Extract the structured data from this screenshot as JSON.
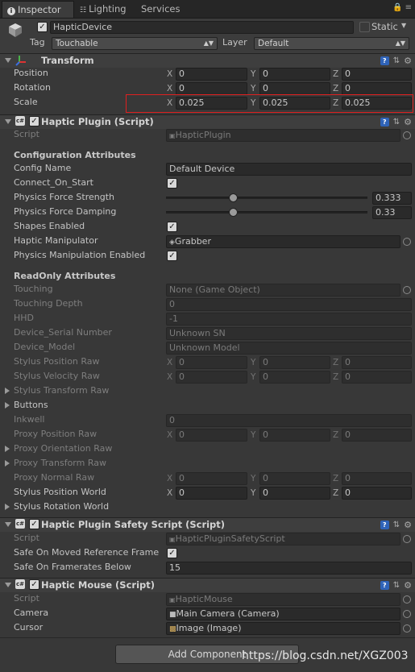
{
  "tabs": [
    {
      "label": "Inspector",
      "icon": "info-icon"
    },
    {
      "label": "Lighting",
      "icon": "lighting-icon"
    },
    {
      "label": "Services",
      "icon": ""
    }
  ],
  "gameobject": {
    "name": "HapticDevice",
    "static_label": "Static",
    "tag_label": "Tag",
    "tag_value": "Touchable",
    "layer_label": "Layer",
    "layer_value": "Default"
  },
  "transform": {
    "title": "Transform",
    "rows": [
      {
        "label": "Position",
        "x": "0",
        "y": "0",
        "z": "0"
      },
      {
        "label": "Rotation",
        "x": "0",
        "y": "0",
        "z": "0"
      },
      {
        "label": "Scale",
        "x": "0.025",
        "y": "0.025",
        "z": "0.025"
      }
    ]
  },
  "axes": {
    "x": "X",
    "y": "Y",
    "z": "Z"
  },
  "haptic_plugin": {
    "title": "Haptic Plugin (Script)",
    "script_label": "Script",
    "script_value": "HapticPlugin",
    "config_header": "Configuration Attributes",
    "config_name_label": "Config Name",
    "config_name_value": "Default Device",
    "connect_label": "Connect_On_Start",
    "force_strength_label": "Physics Force Strength",
    "force_strength_value": "0.333",
    "force_strength_level": 0.333,
    "force_damping_label": "Physics Force Damping",
    "force_damping_value": "0.33",
    "force_damping_level": 0.33,
    "shapes_label": "Shapes Enabled",
    "manipulator_label": "Haptic Manipulator",
    "manipulator_value": "Grabber",
    "manip_enabled_label": "Physics Manipulation Enabled",
    "readonly_header": "ReadOnly Attributes",
    "touching_label": "Touching",
    "touching_value": "None (Game Object)",
    "touching_depth_label": "Touching Depth",
    "touching_depth_value": "0",
    "hhd_label": "HHD",
    "hhd_value": "-1",
    "serial_label": "Device_Serial Number",
    "serial_value": "Unknown SN",
    "model_label": "Device_Model",
    "model_value": "Unknown Model",
    "stylus_pos_raw_label": "Stylus Position Raw",
    "stylus_vel_raw_label": "Stylus Velocity Raw",
    "stylus_transform_raw_label": "Stylus Transform Raw",
    "buttons_label": "Buttons",
    "inkwell_label": "Inkwell",
    "inkwell_value": "0",
    "proxy_pos_raw_label": "Proxy Position Raw",
    "proxy_orient_raw_label": "Proxy Orientation Raw",
    "proxy_transform_raw_label": "Proxy Transform Raw",
    "proxy_normal_raw_label": "Proxy Normal Raw",
    "stylus_pos_world_label": "Stylus Position World",
    "stylus_rot_world_label": "Stylus Rotation World",
    "zero": "0"
  },
  "safety": {
    "title": "Haptic Plugin Safety Script (Script)",
    "script_label": "Script",
    "script_value": "HapticPluginSafetyScript",
    "moved_label": "Safe On Moved Reference Frame",
    "framerates_label": "Safe On Framerates Below",
    "framerates_value": "15"
  },
  "mouse": {
    "title": "Haptic Mouse (Script)",
    "script_label": "Script",
    "script_value": "HapticMouse",
    "camera_label": "Camera",
    "camera_value": "Main Camera (Camera)",
    "cursor_label": "Cursor",
    "cursor_value": "Image (Image)"
  },
  "add_component_label": "Add Component",
  "watermark": "https://blog.csdn.net/XGZ003",
  "colors": {
    "highlight": "#e02020",
    "book_icon": "#2f63b8"
  }
}
